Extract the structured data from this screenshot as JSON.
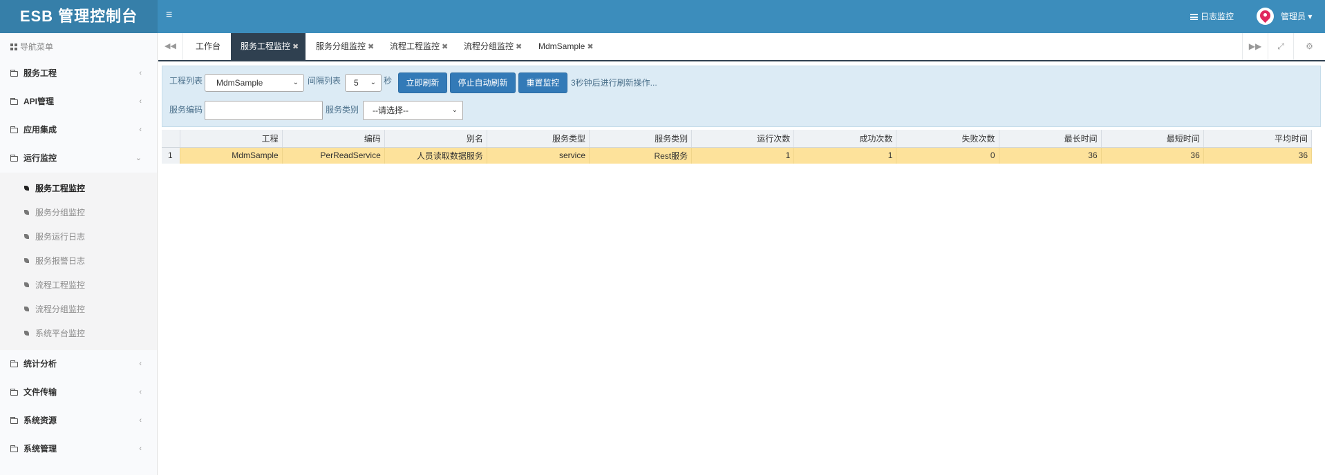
{
  "header": {
    "brand": "ESB 管理控制台",
    "menu_toggle": "≡",
    "log_monitor": "日志监控",
    "user": "管理员 ▾"
  },
  "sidebar": {
    "header": "导航菜单",
    "items": [
      {
        "label": "服务工程"
      },
      {
        "label": "API管理"
      },
      {
        "label": "应用集成"
      },
      {
        "label": "运行监控",
        "expanded": true,
        "children": [
          {
            "label": "服务工程监控",
            "active": true
          },
          {
            "label": "服务分组监控"
          },
          {
            "label": "服务运行日志"
          },
          {
            "label": "服务报警日志"
          },
          {
            "label": "流程工程监控"
          },
          {
            "label": "流程分组监控"
          },
          {
            "label": "系统平台监控"
          }
        ]
      },
      {
        "label": "统计分析"
      },
      {
        "label": "文件传输"
      },
      {
        "label": "系统资源"
      },
      {
        "label": "系统管理"
      }
    ]
  },
  "tabs": [
    {
      "label": "工作台",
      "closable": false
    },
    {
      "label": "服务工程监控",
      "closable": true,
      "active": true
    },
    {
      "label": "服务分组监控",
      "closable": true
    },
    {
      "label": "流程工程监控",
      "closable": true
    },
    {
      "label": "流程分组监控",
      "closable": true
    },
    {
      "label": "MdmSample",
      "closable": true
    }
  ],
  "toolbar": {
    "project_list_label": "工程列表",
    "project_selected": "MdmSample",
    "interval_label": "间隔列表",
    "interval_selected": "5",
    "interval_unit": "秒",
    "refresh_now": "立即刷新",
    "stop_auto_refresh": "停止自动刷新",
    "reset_monitor": "重置监控",
    "status_text": "3秒钟后进行刷新操作...",
    "service_code_label": "服务编码",
    "service_code_value": "",
    "service_category_label": "服务类别",
    "service_category_selected": "--请选择--"
  },
  "table": {
    "columns": [
      "工程",
      "编码",
      "别名",
      "服务类型",
      "服务类别",
      "运行次数",
      "成功次数",
      "失败次数",
      "最长时间",
      "最短时间",
      "平均时间"
    ],
    "rows": [
      {
        "num": "1",
        "cells": [
          "MdmSample",
          "PerReadService",
          "人员读取数据服务",
          "service",
          "Rest服务",
          "1",
          "1",
          "0",
          "36",
          "36",
          "36"
        ]
      }
    ]
  },
  "colors": {
    "header_bg": "#3c8dbc",
    "brand_bg": "#367fa9",
    "active_tab": "#2f4050",
    "button": "#337ab7",
    "selected_row": "#fde29b",
    "panel_bg": "#dcebf5"
  }
}
